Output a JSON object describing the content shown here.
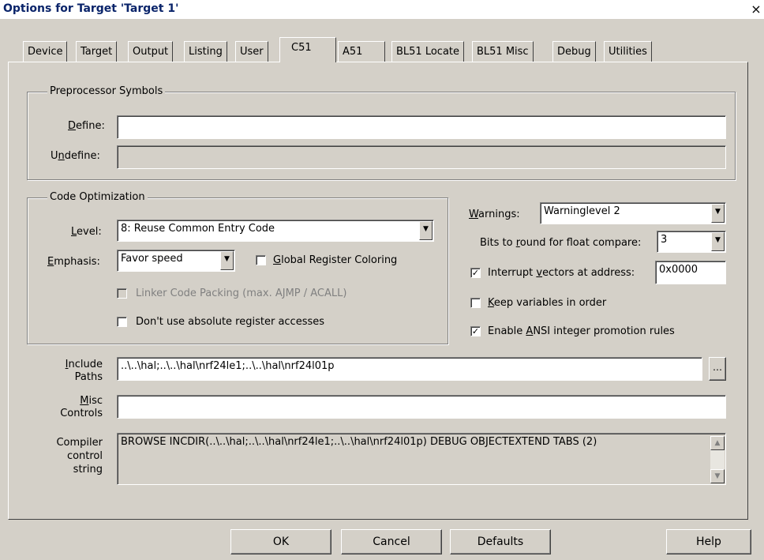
{
  "window": {
    "title": "Options for Target 'Target 1'",
    "close_glyph": "×"
  },
  "tabs": [
    "Device",
    "Target",
    "Output",
    "Listing",
    "User",
    "C51",
    "A51",
    "BL51 Locate",
    "BL51 Misc",
    "Debug",
    "Utilities"
  ],
  "active_tab": "C51",
  "preprocessor": {
    "legend": "Preprocessor Symbols",
    "define_label": "Define:",
    "define_value": "",
    "undefine_label": "Undefine:",
    "undefine_value": ""
  },
  "code_opt": {
    "legend": "Code Optimization",
    "level_label": "Level:",
    "level_value": "8: Reuse Common Entry Code",
    "emphasis_label": "Emphasis:",
    "emphasis_value": "Favor speed",
    "global_reg": "Global Register Coloring",
    "linker_packing": "Linker Code Packing (max. AJMP / ACALL)",
    "no_abs_reg": "Don't use absolute register accesses"
  },
  "right": {
    "warnings_label": "Warnings:",
    "warnings_value": "Warninglevel 2",
    "bits_label": "Bits to round for float compare:",
    "bits_value": "3",
    "interrupt_label": "Interrupt vectors at address:",
    "interrupt_value": "0x0000",
    "interrupt_checked": true,
    "keep_vars": "Keep variables in order",
    "keep_vars_checked": false,
    "ansi": "Enable ANSI integer promotion rules",
    "ansi_checked": true
  },
  "include": {
    "label1": "Include",
    "label2": "Paths",
    "value": "..\\..\\hal;..\\..\\hal\\nrf24le1;..\\..\\hal\\nrf24l01p"
  },
  "misc": {
    "label1": "Misc",
    "label2": "Controls",
    "value": ""
  },
  "compiler": {
    "label1": "Compiler",
    "label2": "control",
    "label3": "string",
    "value": "BROWSE INCDIR(..\\..\\hal;..\\..\\hal\\nrf24le1;..\\..\\hal\\nrf24l01p) DEBUG OBJECTEXTEND TABS (2)"
  },
  "buttons": {
    "ok": "OK",
    "cancel": "Cancel",
    "defaults": "Defaults",
    "help": "Help"
  },
  "icons": {
    "dropdown": "▼",
    "scroll_up": "▲",
    "scroll_down": "▼",
    "check": "✓",
    "browse": "…"
  }
}
